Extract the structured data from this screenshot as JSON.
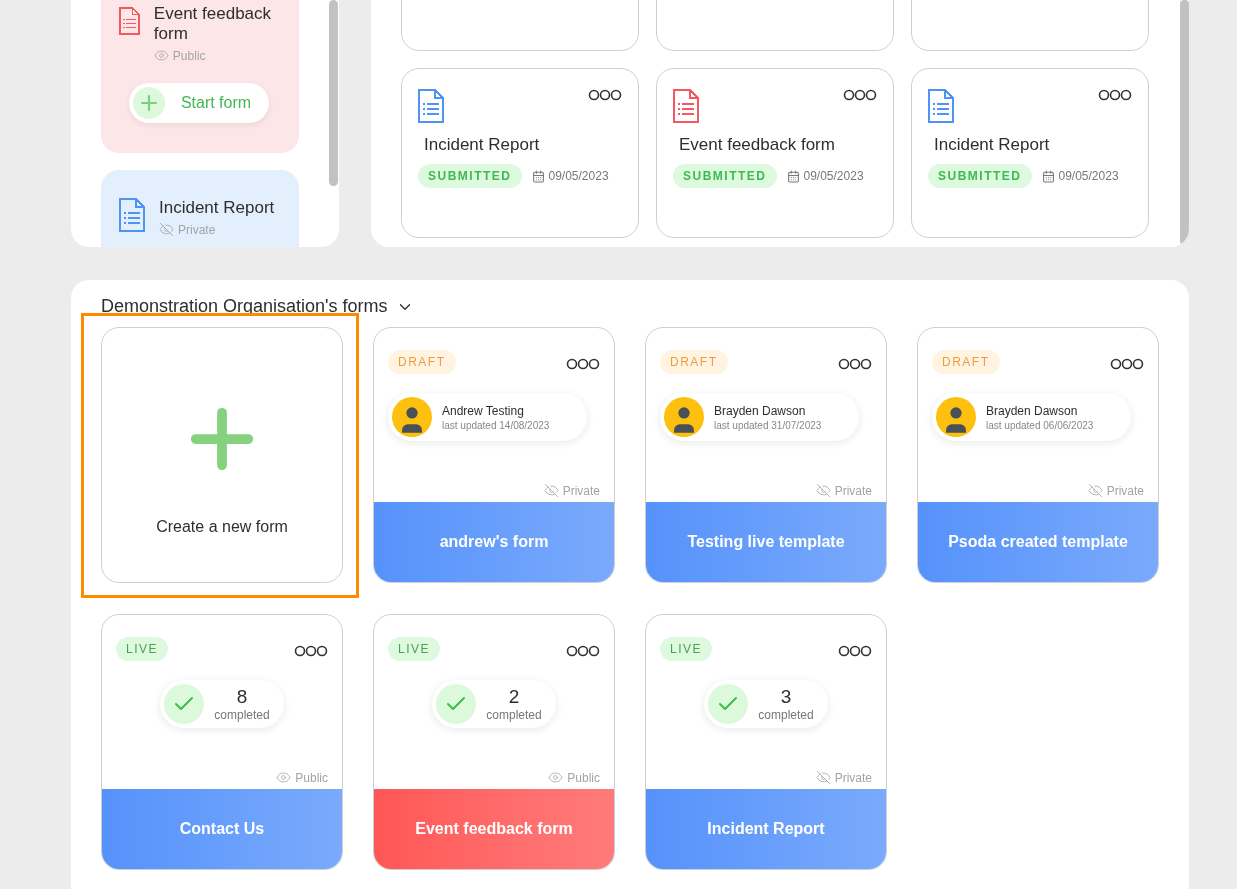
{
  "sidebar": {
    "cards": [
      {
        "title": "Event feedback form",
        "color": "#f25a62",
        "visibility": "Public",
        "hidden": false,
        "action": "Start form"
      },
      {
        "title": "Incident Report",
        "color": "#4d94f5",
        "visibility": "Private",
        "hidden": true
      }
    ]
  },
  "recent": {
    "cards": [
      {
        "title": "Incident Report",
        "color": "#4d94f5",
        "status": "SUBMITTED",
        "date": "09/05/2023"
      },
      {
        "title": "Event feedback form",
        "color": "#f25a62",
        "status": "SUBMITTED",
        "date": "09/05/2023"
      },
      {
        "title": "Incident Report",
        "color": "#4d94f5",
        "status": "SUBMITTED",
        "date": "09/05/2023"
      }
    ]
  },
  "forms_section": {
    "title": "Demonstration Organisation's forms",
    "create": {
      "label": "Create a new form",
      "highlighted": true
    },
    "cards": [
      {
        "kind": "draft",
        "status": "DRAFT",
        "author": "Andrew Testing",
        "updated": "last updated 14/08/2023",
        "visibility": "Private",
        "hidden": true,
        "title": "andrew's form",
        "color": "#5592fb"
      },
      {
        "kind": "draft",
        "status": "DRAFT",
        "author": "Brayden Dawson",
        "updated": "last updated 31/07/2023",
        "visibility": "Private",
        "hidden": true,
        "title": "Testing live template",
        "color": "#5592fb"
      },
      {
        "kind": "draft",
        "status": "DRAFT",
        "author": "Brayden Dawson",
        "updated": "last updated 06/06/2023",
        "visibility": "Private",
        "hidden": true,
        "title": "Psoda created template",
        "color": "#5592fb"
      },
      {
        "kind": "live",
        "status": "LIVE",
        "count": "8",
        "count_label": "completed",
        "visibility": "Public",
        "hidden": false,
        "title": "Contact Us",
        "color": "#5592fb"
      },
      {
        "kind": "live",
        "status": "LIVE",
        "count": "2",
        "count_label": "completed",
        "visibility": "Public",
        "hidden": false,
        "title": "Event feedback form",
        "color": "#ff5656"
      },
      {
        "kind": "live",
        "status": "LIVE",
        "count": "3",
        "count_label": "completed",
        "visibility": "Private",
        "hidden": true,
        "title": "Incident Report",
        "color": "#5592fb"
      }
    ]
  }
}
